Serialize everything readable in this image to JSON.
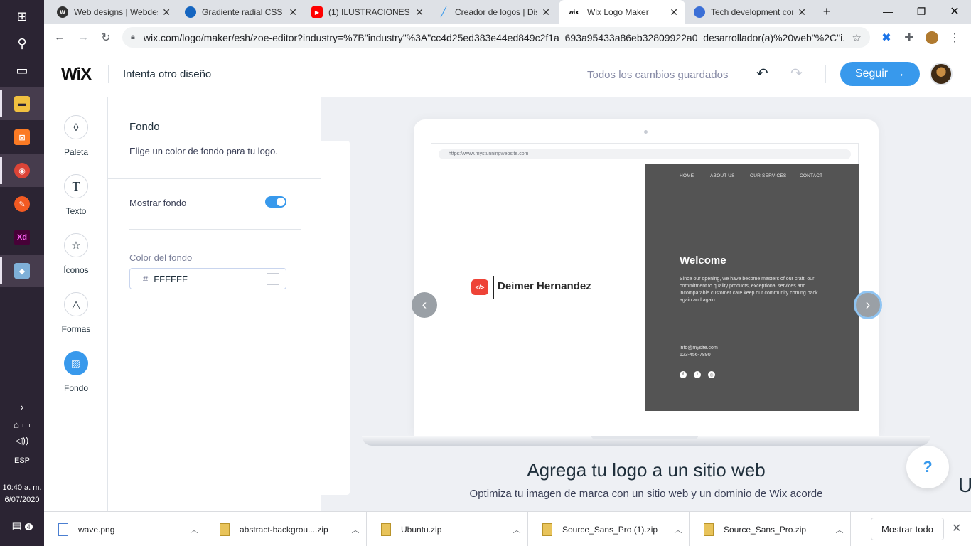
{
  "taskbar": {
    "lang": "ESP",
    "time": "10:40 a. m.",
    "date": "6/07/2020",
    "notif_count": "4"
  },
  "browser": {
    "tabs": [
      {
        "title": "Web designs | Webdesign",
        "fav_letter": "W",
        "fav_color": "#333333"
      },
      {
        "title": "Gradiente radial CSS - ",
        "fav_letter": "",
        "fav_color": "#1565c0"
      },
      {
        "title": "(1) ILUSTRACIONES SVG",
        "fav_letter": "▶",
        "fav_color": "#ff0000"
      },
      {
        "title": "Creador de logos | Diseño",
        "fav_letter": "",
        "fav_color": "#9ecbf5"
      },
      {
        "title": "Wix Logo Maker",
        "fav_letter": "wix",
        "fav_color": "#ffffff"
      },
      {
        "title": "Tech development com",
        "fav_letter": "",
        "fav_color": "#3b6fd6"
      }
    ],
    "url": "wix.com/logo/maker/esh/zoe-editor?industry=%7B\"industry\"%3A\"cc4d25ed383e44ed849c2f1a_693a95433a86eb32809922a0_desarrollador(a)%20web\"%2C\"i..."
  },
  "header": {
    "logo": "WiX",
    "try_other": "Intenta otro diseño",
    "saved_status": "Todos los cambios guardados",
    "next_label": "Seguir"
  },
  "tools": [
    {
      "label": "Paleta",
      "icon": "droplet-icon"
    },
    {
      "label": "Texto",
      "icon": "text-icon"
    },
    {
      "label": "Íconos",
      "icon": "star-icon"
    },
    {
      "label": "Formas",
      "icon": "shapes-icon"
    },
    {
      "label": "Fondo",
      "icon": "background-icon"
    }
  ],
  "panel": {
    "title": "Fondo",
    "description": "Elige un color de fondo para tu logo.",
    "show_bg_label": "Mostrar fondo",
    "show_bg_enabled": true,
    "color_label": "Color del fondo",
    "color_value": "FFFFFF"
  },
  "mockup": {
    "site_url": "https://www.mystunningwebsite.com",
    "logo_name": "Deimer Hernandez",
    "logo_badge": "</>",
    "nav": [
      "HOME",
      "ABOUT US",
      "OUR SERVICES",
      "CONTACT"
    ],
    "welcome": "Welcome",
    "welcome_text": "Since our opening, we have become masters of our craft. our commitment to quality products, exceptional services and incomparable customer care keep our community coming back again and again.",
    "email": "info@mysite.com",
    "phone": "123-456-7890"
  },
  "canvas": {
    "title": "Agrega tu logo a un sitio web",
    "subtitle": "Optimiza tu imagen de marca con un sitio web y un dominio de Wix acorde",
    "help": "?",
    "edge_letter": "U"
  },
  "downloads": {
    "items": [
      "wave.png",
      "abstract-backgrou....zip",
      "Ubuntu.zip",
      "Source_Sans_Pro (1).zip",
      "Source_Sans_Pro.zip"
    ],
    "show_all": "Mostrar todo"
  },
  "colors": {
    "accent": "#3899ec",
    "logo_red": "#ee4337",
    "site_dark": "#545454"
  }
}
